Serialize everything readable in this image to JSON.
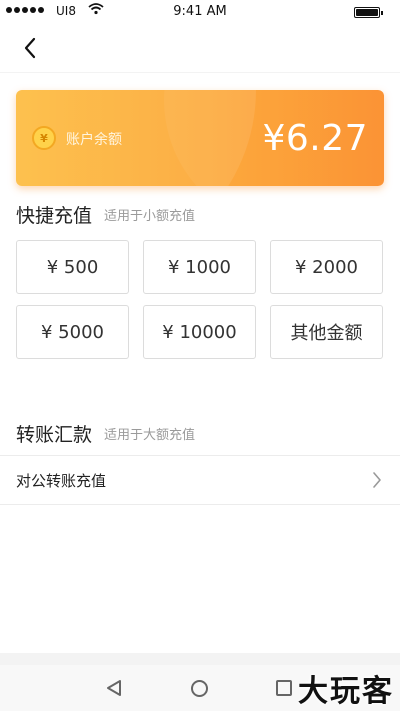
{
  "status_bar": {
    "carrier": "UI8",
    "time": "9:41 AM"
  },
  "balance_card": {
    "coin_symbol": "¥",
    "label": "账户余额",
    "amount": "¥6.27"
  },
  "quick_recharge": {
    "title": "快捷充值",
    "subtitle": "适用于小额充值",
    "options": [
      "¥ 500",
      "¥ 1000",
      "¥ 2000",
      "¥ 5000",
      "¥ 10000",
      "其他金额"
    ]
  },
  "transfer": {
    "title": "转账汇款",
    "subtitle": "适用于大额充值",
    "row_label": "对公转账充值"
  },
  "watermark": "大玩客",
  "colors": {
    "card_gradient_start": "#fdbb3d",
    "card_gradient_end": "#fb8e2b",
    "option_border": "#dcdcdc",
    "muted_text": "#9a9a9a"
  }
}
